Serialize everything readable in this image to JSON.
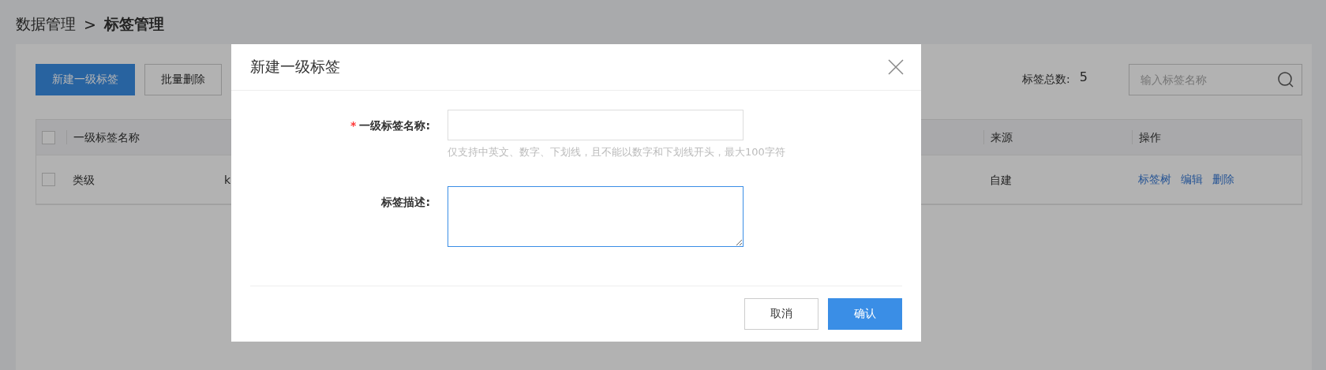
{
  "breadcrumb": {
    "parent": "数据管理",
    "separator": ">",
    "current": "标签管理"
  },
  "toolbar": {
    "buttons": [
      {
        "label": "新建一级标签",
        "kind": "primary"
      },
      {
        "label": "批量删除",
        "kind": "default"
      }
    ],
    "count_label": "标签总数:",
    "count": "5",
    "search": {
      "placeholder": "输入标签名称"
    }
  },
  "table": {
    "select_all_checked": false,
    "columns": [
      "一级标签名称",
      "",
      "来源",
      "操作"
    ],
    "rows": [
      {
        "checked": false,
        "name": "类级",
        "column_2": "k",
        "source": "自建",
        "actions": [
          "标签树",
          "编辑",
          "删除"
        ]
      }
    ]
  },
  "dialog": {
    "title": "新建一级标签",
    "fields": [
      {
        "kind": "input",
        "label": "一级标签名称:",
        "required_mark": "*",
        "hint": "仅支持中英文、数字、下划线，且不能以数字和下划线开头，最大100字符",
        "focused": false
      },
      {
        "kind": "textarea",
        "label": "标签描述:",
        "focused": true
      }
    ],
    "buttons": [
      {
        "label": "取消",
        "kind": "default"
      },
      {
        "label": "确认",
        "kind": "primary"
      }
    ]
  }
}
